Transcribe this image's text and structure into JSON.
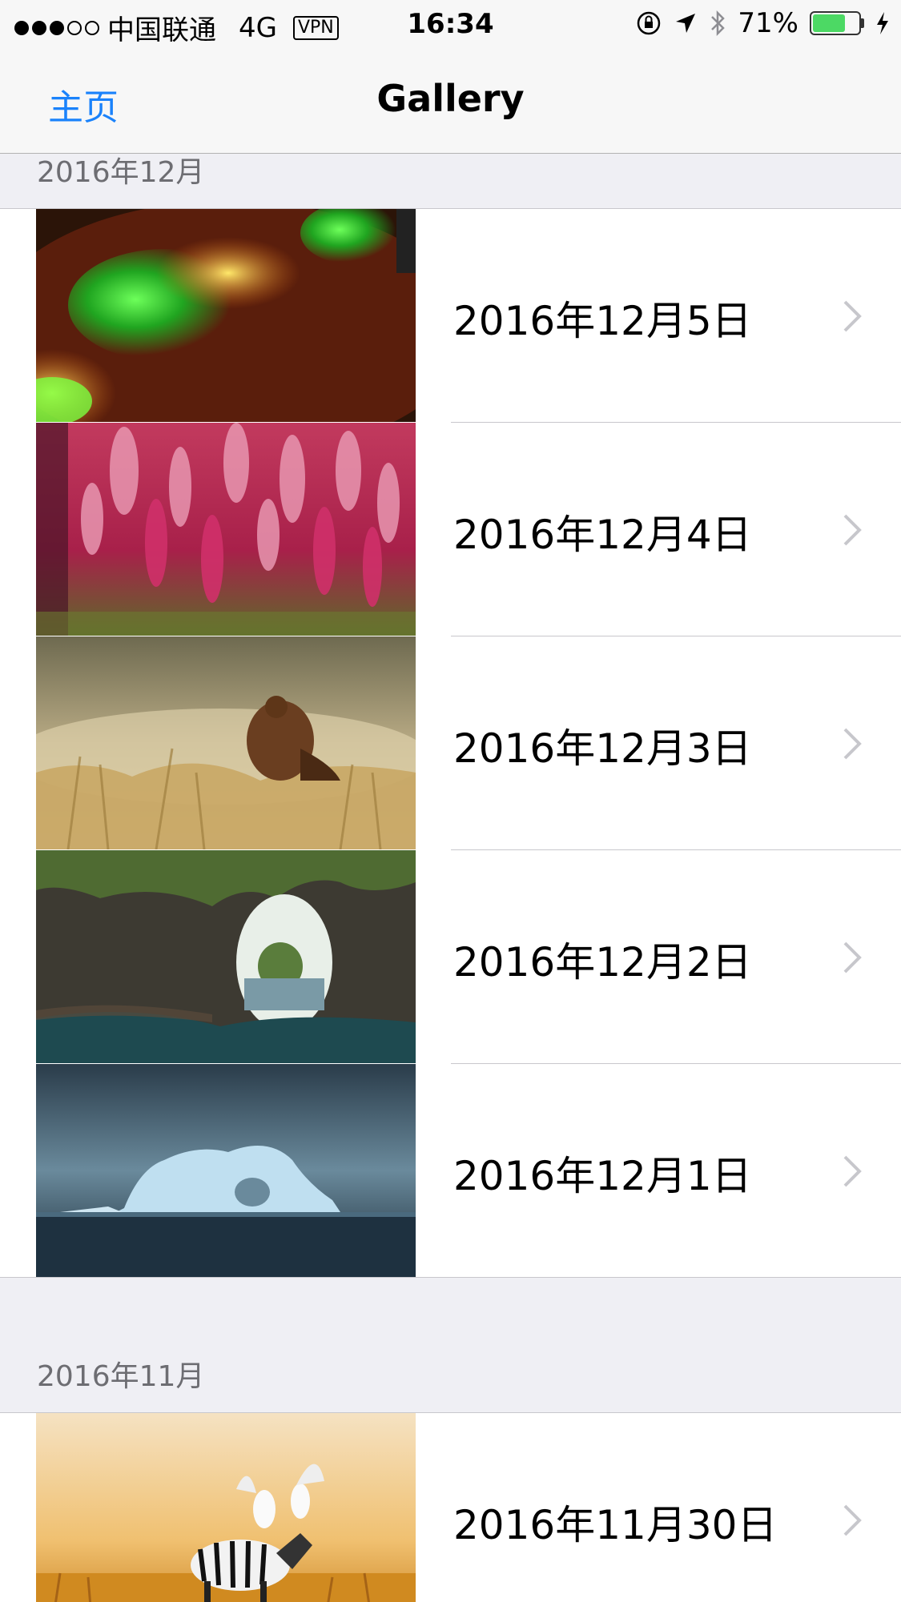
{
  "status_bar": {
    "carrier": "中国联通",
    "network": "4G",
    "vpn": "VPN",
    "time": "16:34",
    "battery": "71%",
    "battery_level": 0.71
  },
  "nav": {
    "back_label": "主页",
    "title": "Gallery"
  },
  "sections": [
    {
      "header": "2016年12月",
      "rows": [
        {
          "label": "2016年12月5日",
          "thumbnail": "green-yellow-lights-photo"
        },
        {
          "label": "2016年12月4日",
          "thumbnail": "pink-flowers-photo"
        },
        {
          "label": "2016年12月3日",
          "thumbnail": "grouse-in-grass-photo"
        },
        {
          "label": "2016年12月2日",
          "thumbnail": "sea-arch-rock-photo"
        },
        {
          "label": "2016年12月1日",
          "thumbnail": "iceberg-photo"
        }
      ]
    },
    {
      "header": "2016年11月",
      "rows": [
        {
          "label": "2016年11月30日",
          "thumbnail": "zebra-with-birds-photo"
        }
      ]
    }
  ],
  "colors": {
    "accent": "#1a82fb",
    "background": "#efeff4",
    "battery_green": "#4cd964",
    "chevron": "#c7c7cc"
  }
}
